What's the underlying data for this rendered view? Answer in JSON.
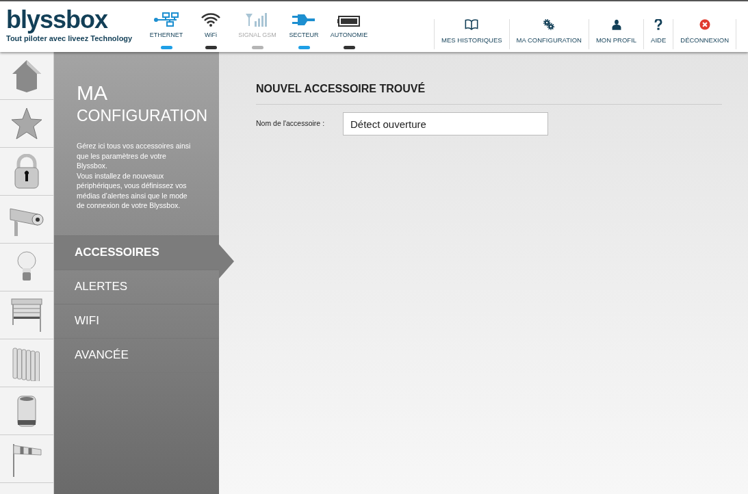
{
  "logo": {
    "name": "blyssbox",
    "tagline": "Tout piloter avec liveez Technology"
  },
  "status_indicators": [
    {
      "label": "ETHERNET",
      "kind": "ethernet",
      "active": true,
      "disabled": false
    },
    {
      "label": "WiFi",
      "kind": "wifi",
      "active": false,
      "disabled": false
    },
    {
      "label": "SIGNAL GSM",
      "kind": "gsm",
      "active": false,
      "disabled": true
    },
    {
      "label": "SECTEUR",
      "kind": "plug",
      "active": true,
      "disabled": false
    },
    {
      "label": "AUTONOMIE",
      "kind": "battery",
      "active": false,
      "disabled": false
    }
  ],
  "top_nav": [
    {
      "label": "MES HISTORIQUES",
      "kind": "book"
    },
    {
      "label": "MA CONFIGURATION",
      "kind": "gears"
    },
    {
      "label": "MON PROFIL",
      "kind": "person"
    },
    {
      "label": "AIDE",
      "kind": "help"
    },
    {
      "label": "DÉCONNEXION",
      "kind": "logout"
    }
  ],
  "side_panel": {
    "title_line_1": "MA",
    "title_line_2": "CONFIGURATION",
    "description": [
      "Gérez ici tous vos accessoires ainsi que les paramètres de votre Blyssbox.",
      "Vous installez de nouveaux périphériques, vous définissez vos médias d’alertes ainsi que le mode de connexion de votre Blyssbox."
    ],
    "menu": [
      {
        "label": "ACCESSOIRES",
        "selected": true
      },
      {
        "label": "ALERTES",
        "selected": false
      },
      {
        "label": "WIFI",
        "selected": false
      },
      {
        "label": "AVANCÉE",
        "selected": false
      }
    ]
  },
  "content": {
    "title": "NOUVEL ACCESSOIRE TROUVÉ",
    "field": {
      "label": "Nom de l'accessoire :",
      "value": "Détect ouverture"
    }
  }
}
